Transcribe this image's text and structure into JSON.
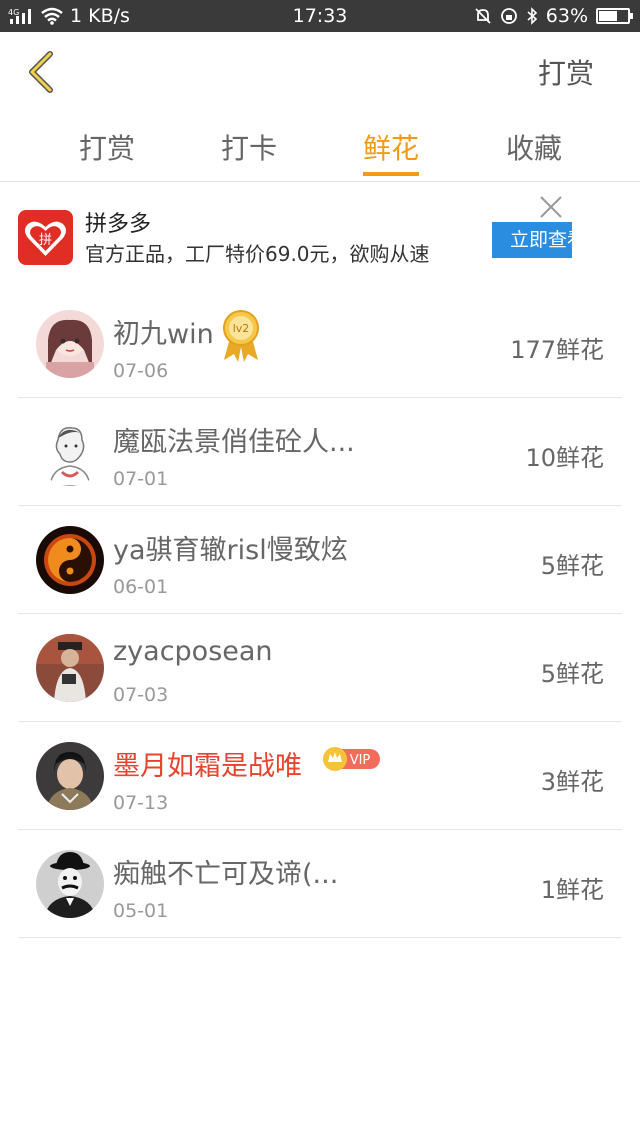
{
  "status_bar": {
    "network": "4G",
    "speed": "1 KB/s",
    "time": "17:33",
    "battery": "63%",
    "battery_level": 0.63
  },
  "header": {
    "reward_label": "打赏"
  },
  "tabs": [
    {
      "label": "打赏",
      "active": false
    },
    {
      "label": "打卡",
      "active": false
    },
    {
      "label": "鲜花",
      "active": true
    },
    {
      "label": "收藏",
      "active": false
    }
  ],
  "ad": {
    "title": "拼多多",
    "logo_text": "拼",
    "description": "官方正品，工厂特价69.0元，欲购从速",
    "cta": "立即查看"
  },
  "list": [
    {
      "name": "初九win",
      "date": "07-06",
      "flowers": "177鲜花",
      "badge": "lv2"
    },
    {
      "name": "魔瓯法景俏佳砼人...",
      "date": "07-01",
      "flowers": "10鲜花"
    },
    {
      "name": "ya骐育辙risl慢致炫",
      "date": "06-01",
      "flowers": "5鲜花"
    },
    {
      "name": "zyacposean",
      "date": "07-03",
      "flowers": "5鲜花"
    },
    {
      "name": "墨月如霜是战唯",
      "date": "07-13",
      "flowers": "3鲜花",
      "badge": "VIP"
    },
    {
      "name": "痴触不亡可及谛(...",
      "date": "05-01",
      "flowers": "1鲜花"
    }
  ],
  "colors": {
    "accent": "#f29b12",
    "vip_name": "#e8432f",
    "ad_button": "#2a8de0",
    "ad_logo": "#e02e24"
  }
}
